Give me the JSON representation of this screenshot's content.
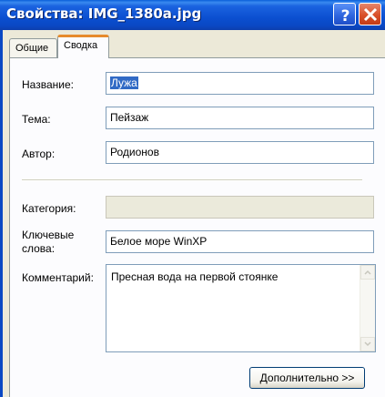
{
  "window": {
    "title": "Свойства: IMG_1380a.jpg",
    "help_icon": "help-icon",
    "close_icon": "close-icon"
  },
  "tabs": [
    {
      "label": "Общие",
      "active": false
    },
    {
      "label": "Сводка",
      "active": true
    }
  ],
  "form": {
    "title_label": "Название:",
    "title_value": "Лужа",
    "subject_label": "Тема:",
    "subject_value": "Пейзаж",
    "author_label": "Автор:",
    "author_value": "Родионов",
    "category_label": "Категория:",
    "category_value": "",
    "keywords_label_line1": "Ключевые",
    "keywords_label_line2": "слова:",
    "keywords_value": "Белое море WinXP",
    "comments_label": "Комментарий:",
    "comments_value": "Пресная вода на первой стоянке"
  },
  "buttons": {
    "advanced_label": "Дополнительно >>"
  },
  "colors": {
    "titlebar": "#0b4fd0",
    "selection": "#316ac5",
    "active_tab_accent": "#e68b2c",
    "window_bg": "#ece9d8"
  }
}
